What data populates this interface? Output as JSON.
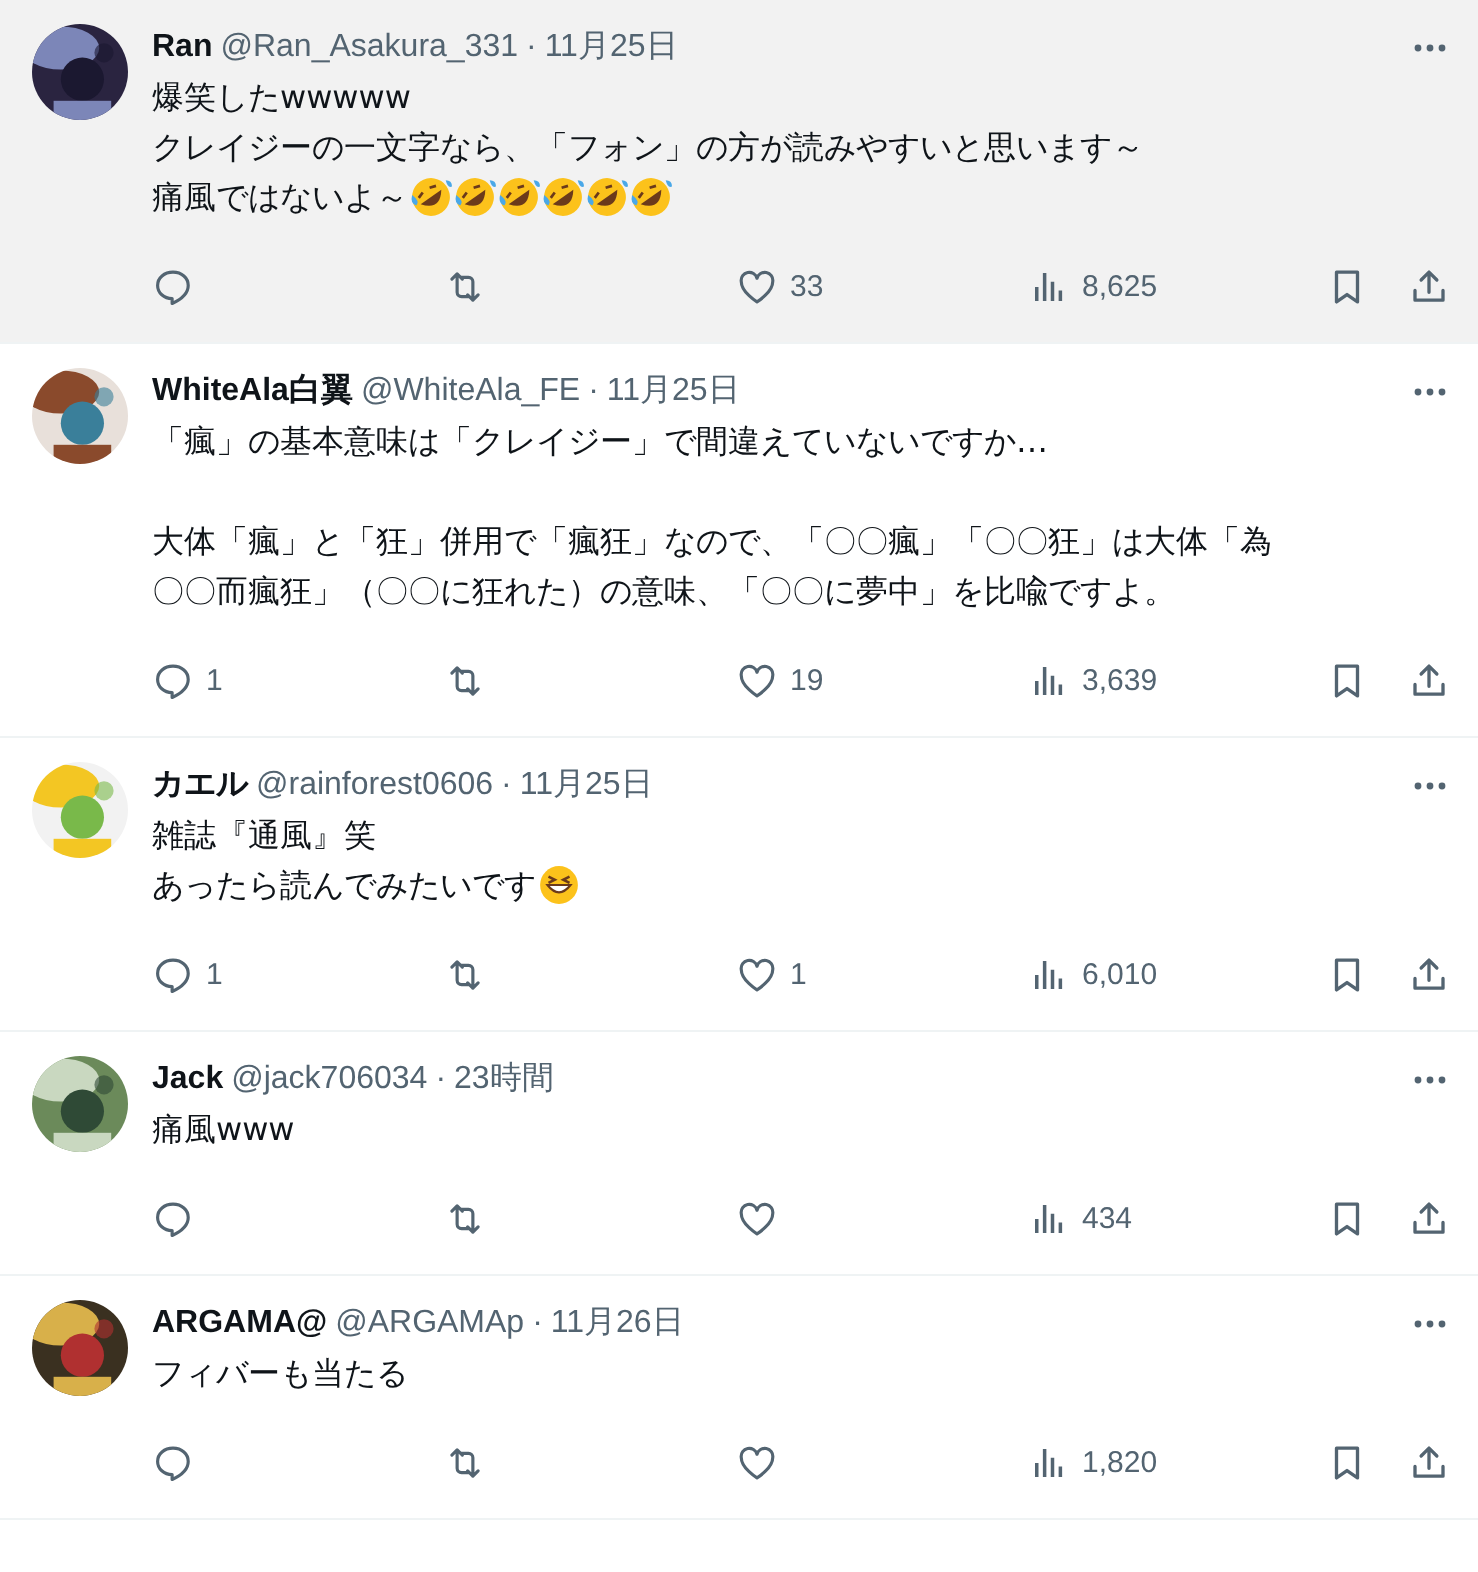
{
  "posts": [
    {
      "highlighted": true,
      "name": "Ran",
      "handle": "@Ran_Asakura_331",
      "separator": "·",
      "time": "11月25日",
      "paragraphs": [
        [
          [
            {
              "kind": "text",
              "text": "爆笑したwwwww"
            }
          ],
          [
            {
              "kind": "text",
              "text": "クレイジーの一文字なら、「フォン」の方が読みやすいと思います～"
            }
          ],
          [
            {
              "kind": "text",
              "text": "痛風ではないよ～"
            },
            {
              "kind": "rofl"
            },
            {
              "kind": "rofl"
            },
            {
              "kind": "rofl"
            },
            {
              "kind": "rofl"
            },
            {
              "kind": "rofl"
            },
            {
              "kind": "rofl"
            }
          ]
        ]
      ],
      "likes": "33",
      "views": "8,625"
    },
    {
      "highlighted": false,
      "name": "WhiteAla白翼",
      "handle": "@WhiteAla_FE",
      "separator": "·",
      "time": "11月25日",
      "paragraphs": [
        [
          [
            {
              "kind": "text",
              "text": "「瘋」の基本意味は「クレイジー」で間違えていないですか…"
            }
          ]
        ],
        [
          [
            {
              "kind": "text",
              "text": "大体「瘋」と「狂」併用で「瘋狂」なので、「〇〇瘋」「〇〇狂」は大体「為"
            }
          ],
          [
            {
              "kind": "text",
              "text": "〇〇而瘋狂」（〇〇に狂れた）の意味、「〇〇に夢中」を比喩ですよ。"
            }
          ]
        ]
      ],
      "replies": "1",
      "likes": "19",
      "views": "3,639"
    },
    {
      "highlighted": false,
      "name": "カエル",
      "handle": "@rainforest0606",
      "separator": "·",
      "time": "11月25日",
      "paragraphs": [
        [
          [
            {
              "kind": "text",
              "text": "雑誌『通風』笑"
            }
          ],
          [
            {
              "kind": "text",
              "text": "あったら読んでみたいです"
            },
            {
              "kind": "grin"
            }
          ]
        ]
      ],
      "replies": "1",
      "likes": "1",
      "views": "6,010"
    },
    {
      "highlighted": false,
      "name": "Jack",
      "handle": "@jack706034",
      "separator": "·",
      "time": "23時間",
      "paragraphs": [
        [
          [
            {
              "kind": "text",
              "text": "痛風www"
            }
          ]
        ]
      ],
      "views": "434"
    },
    {
      "highlighted": false,
      "name": "ARGAMA@",
      "handle": "@ARGAMAp",
      "separator": "·",
      "time": "11月26日",
      "paragraphs": [
        [
          [
            {
              "kind": "text",
              "text": "フィバーも当たる"
            }
          ]
        ]
      ],
      "views": "1,820"
    }
  ]
}
